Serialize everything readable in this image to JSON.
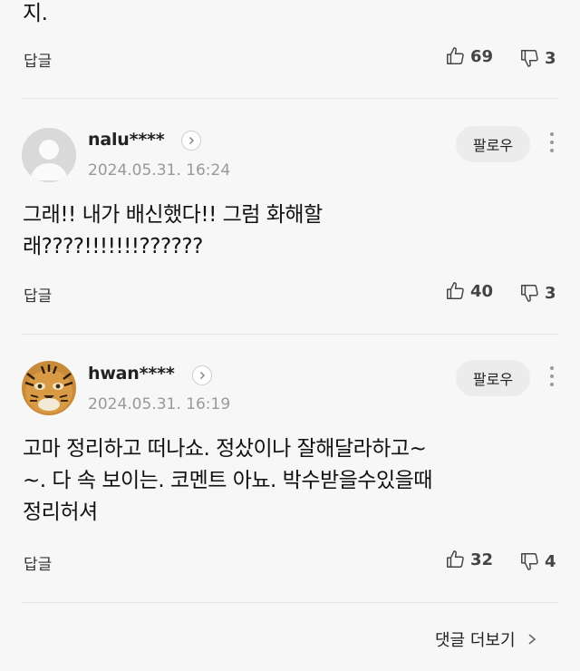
{
  "top_comment": {
    "text_tail": "지.",
    "reply_label": "답글",
    "likes": "69",
    "dislikes": "3"
  },
  "comments": [
    {
      "username": "nalu****",
      "date": "2024.05.31. 16:24",
      "follow_label": "팔로우",
      "text_lines": [
        "그래!! 내가 배신했다!! 그럼 화해할",
        "래????!!!!!!!??????"
      ],
      "reply_label": "답글",
      "likes": "40",
      "dislikes": "3"
    },
    {
      "username": "hwan****",
      "date": "2024.05.31. 16:19",
      "follow_label": "팔로우",
      "text_lines": [
        "고마 정리하고 떠나쇼. 정샀이나 잘해달라하고~",
        "~. 다 속 보이는. 코멘트 아뇨. 박수받을수있을때",
        "정리허셔"
      ],
      "reply_label": "답글",
      "likes": "32",
      "dislikes": "4"
    }
  ],
  "more_comments_label": "댓글 더보기",
  "icons": {
    "like": "thumbs-up-icon",
    "dislike": "thumbs-down-icon",
    "profile": "chevron-right-icon",
    "menu": "more-vertical-icon",
    "more": "chevron-right-icon"
  }
}
